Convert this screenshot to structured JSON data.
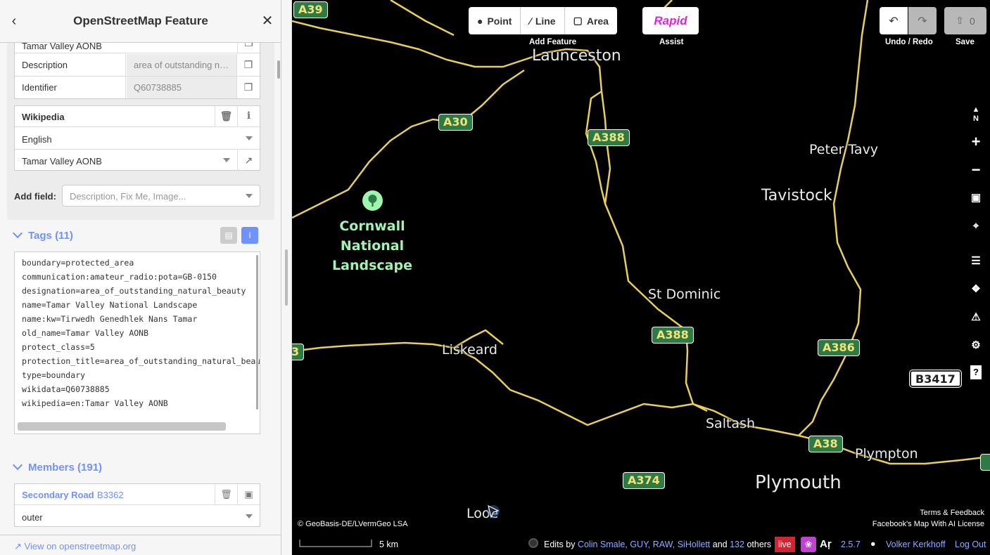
{
  "sidebar": {
    "title": "OpenStreetMap Feature",
    "wikidata": {
      "partial_value": "Tamar Valley AONB",
      "rows": [
        {
          "key": "Description",
          "value": "area of outstanding natural beauty"
        },
        {
          "key": "Identifier",
          "value": "Q60738885"
        }
      ]
    },
    "wikipedia": {
      "label": "Wikipedia",
      "language": "English",
      "title": "Tamar Valley AONB"
    },
    "add_field": {
      "label": "Add field:",
      "placeholder": "Description, Fix Me, Image..."
    },
    "tags": {
      "title": "Tags (11)",
      "lines": [
        "boundary=protected_area",
        "communication:amateur_radio:pota=GB-0150",
        "designation=area_of_outstanding_natural_beauty",
        "name=Tamar Valley National Landscape",
        "name:kw=Tirwedh Genedhlek Nans Tamar",
        "old_name=Tamar Valley AONB",
        "protect_class=5",
        "protection_title=area_of_outstanding_natural_beauty",
        "type=boundary",
        "wikidata=Q60738885",
        "wikipedia=en:Tamar Valley AONB"
      ]
    },
    "members": {
      "title": "Members (191)",
      "first": {
        "type": "Secondary Road",
        "ref": "B3362",
        "role": "outer"
      }
    },
    "footer_link": "View on openstreetmap.org"
  },
  "toolbar": {
    "point": "Point",
    "line": "Line",
    "area": "Area",
    "add_feature_label": "Add Feature",
    "rapid": "Rapid",
    "assist_label": "Assist",
    "undo_redo_label": "Undo / Redo",
    "save_count": "0",
    "save_label": "Save"
  },
  "map": {
    "places": [
      {
        "name": "Launceston",
        "size": 22
      },
      {
        "name": "Peter Tavy",
        "size": 19
      },
      {
        "name": "Tavistock",
        "size": 22
      },
      {
        "name": "St Dominic",
        "size": 19
      },
      {
        "name": "Liskeard",
        "size": 19
      },
      {
        "name": "Saltash",
        "size": 19
      },
      {
        "name": "Plympton",
        "size": 19
      },
      {
        "name": "Plymouth",
        "size": 26
      },
      {
        "name": "Looe",
        "size": 19
      }
    ],
    "park_name": "Cornwall National Landscape",
    "shields": [
      "A39",
      "A30",
      "A388",
      "A388",
      "A386",
      "B3417",
      "A38",
      "A374",
      "3"
    ],
    "attribution_left": "© GeoBasis-DE/LVermGeo LSA",
    "terms": "Terms & Feedback",
    "license": "Facebook's Map With AI License"
  },
  "footer": {
    "scale": "5 km",
    "edits_prefix": "Edits by",
    "editors": [
      "Colin Smale,",
      "GUY,",
      "RAW,",
      "SiHollett"
    ],
    "and": "and",
    "others_count": "132",
    "others": "others",
    "live": "live",
    "version": "2.5.7",
    "user": "Volker Kerkhoff",
    "logout": "Log Out"
  }
}
